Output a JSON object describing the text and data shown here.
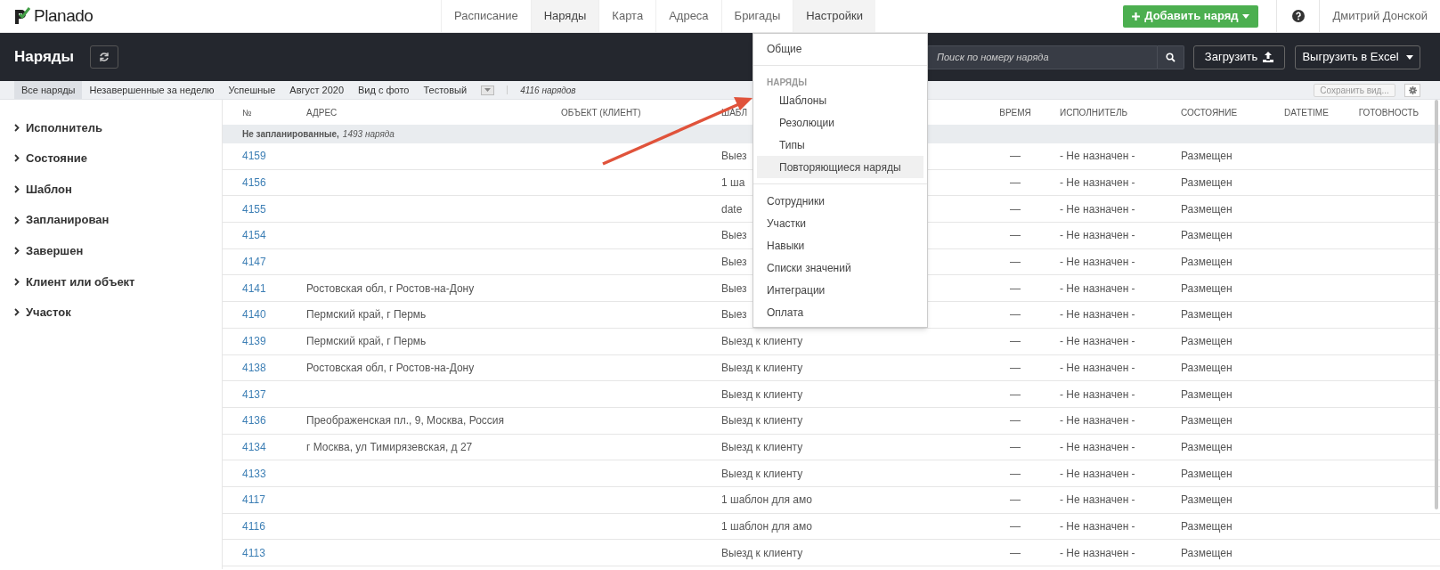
{
  "header": {
    "logo": "Planado",
    "nav": [
      {
        "label": "Расписание",
        "selected": false
      },
      {
        "label": "Наряды",
        "selected": true
      },
      {
        "label": "Карта",
        "selected": false
      },
      {
        "label": "Адреса",
        "selected": false
      },
      {
        "label": "Бригады",
        "selected": false
      },
      {
        "label": "Настройки",
        "selected": true
      }
    ],
    "add_button": "Добавить наряд",
    "user": "Дмитрий Донской"
  },
  "toolbar": {
    "title": "Наряды",
    "search": {
      "placeholder": "Поиск по номеру наряда"
    },
    "upload_button": "Загрузить",
    "export_button": "Выгрузить в Excel"
  },
  "views": [
    {
      "label": "Все наряды",
      "selected": true
    },
    {
      "label": "Незавершенные за неделю",
      "selected": false
    },
    {
      "label": "Успешные",
      "selected": false
    },
    {
      "label": "Август 2020",
      "selected": false
    },
    {
      "label": "Вид с фото",
      "selected": false
    },
    {
      "label": "Тестовый",
      "selected": false
    }
  ],
  "count": "4116 нарядов",
  "save_view_button": {
    "label": "Сохранить вид...",
    "disabled": true
  },
  "filters": [
    "Исполнитель",
    "Состояние",
    "Шаблон",
    "Запланирован",
    "Завершен",
    "Клиент или объект",
    "Участок"
  ],
  "table": {
    "columns": [
      "№",
      "АДРЕС",
      "ОБЪЕКТ (КЛИЕНТ)",
      "ШАБЛ",
      "ВРЕМЯ",
      "ИСПОЛНИТЕЛЬ",
      "СОСТОЯНИЕ",
      "DATETIME",
      "ГОТОВНОСТЬ"
    ],
    "group": {
      "label": "Не запланированные,",
      "count": "1493 наряда"
    },
    "rows": [
      {
        "number": "4159",
        "template": "Выез",
        "time": "—",
        "executor": "- Не назначен -",
        "state": "Размещен"
      },
      {
        "number": "4156",
        "template": "1 ша",
        "time": "—",
        "executor": "- Не назначен -",
        "state": "Размещен"
      },
      {
        "number": "4155",
        "template": "date",
        "time": "—",
        "executor": "- Не назначен -",
        "state": "Размещен"
      },
      {
        "number": "4154",
        "template": "Выез",
        "time": "—",
        "executor": "- Не назначен -",
        "state": "Размещен"
      },
      {
        "number": "4147",
        "template": "Выез",
        "time": "—",
        "executor": "- Не назначен -",
        "state": "Размещен"
      },
      {
        "number": "4141",
        "address": "Ростовская обл, г Ростов-на-Дону",
        "template": "Выез",
        "time": "—",
        "executor": "- Не назначен -",
        "state": "Размещен"
      },
      {
        "number": "4140",
        "address": "Пермский край, г Пермь",
        "template": "Выез",
        "time": "—",
        "executor": "- Не назначен -",
        "state": "Размещен"
      },
      {
        "number": "4139",
        "address": "Пермский край, г Пермь",
        "template": "Выезд к клиенту",
        "time": "—",
        "executor": "- Не назначен -",
        "state": "Размещен"
      },
      {
        "number": "4138",
        "address": "Ростовская обл, г Ростов-на-Дону",
        "template": "Выезд к клиенту",
        "time": "—",
        "executor": "- Не назначен -",
        "state": "Размещен"
      },
      {
        "number": "4137",
        "template": "Выезд к клиенту",
        "time": "—",
        "executor": "- Не назначен -",
        "state": "Размещен"
      },
      {
        "number": "4136",
        "address": "Преображенская пл., 9, Москва, Россия",
        "template": "Выезд к клиенту",
        "time": "—",
        "executor": "- Не назначен -",
        "state": "Размещен"
      },
      {
        "number": "4134",
        "address": "г Москва, ул Тимирязевская, д 27",
        "template": "Выезд к клиенту",
        "time": "—",
        "executor": "- Не назначен -",
        "state": "Размещен"
      },
      {
        "number": "4133",
        "template": "Выезд к клиенту",
        "time": "—",
        "executor": "- Не назначен -",
        "state": "Размещен"
      },
      {
        "number": "4117",
        "template": "1 шаблон для амо",
        "time": "—",
        "executor": "- Не назначен -",
        "state": "Размещен"
      },
      {
        "number": "4116",
        "template": "1 шаблон для амо",
        "time": "—",
        "executor": "- Не назначен -",
        "state": "Размещен"
      },
      {
        "number": "4113",
        "template": "Выезд к клиенту",
        "time": "—",
        "executor": "- Не назначен -",
        "state": "Размещен"
      }
    ]
  },
  "settings_menu": {
    "items": [
      {
        "kind": "item",
        "label": "Общие",
        "highlighted": false
      },
      {
        "kind": "divider"
      },
      {
        "kind": "header",
        "label": "НАРЯДЫ"
      },
      {
        "kind": "subitem",
        "label": "Шаблоны",
        "highlighted": false
      },
      {
        "kind": "subitem",
        "label": "Резолюции",
        "highlighted": false
      },
      {
        "kind": "subitem",
        "label": "Типы",
        "highlighted": false
      },
      {
        "kind": "subitem",
        "label": "Повторяющиеся наряды",
        "highlighted": true
      },
      {
        "kind": "divider"
      },
      {
        "kind": "item",
        "label": "Сотрудники",
        "highlighted": false
      },
      {
        "kind": "item",
        "label": "Участки",
        "highlighted": false
      },
      {
        "kind": "item",
        "label": "Навыки",
        "highlighted": false
      },
      {
        "kind": "item",
        "label": "Списки значений",
        "highlighted": false
      },
      {
        "kind": "item",
        "label": "Интеграции",
        "highlighted": false
      },
      {
        "kind": "item",
        "label": "Оплата",
        "highlighted": false
      }
    ]
  }
}
